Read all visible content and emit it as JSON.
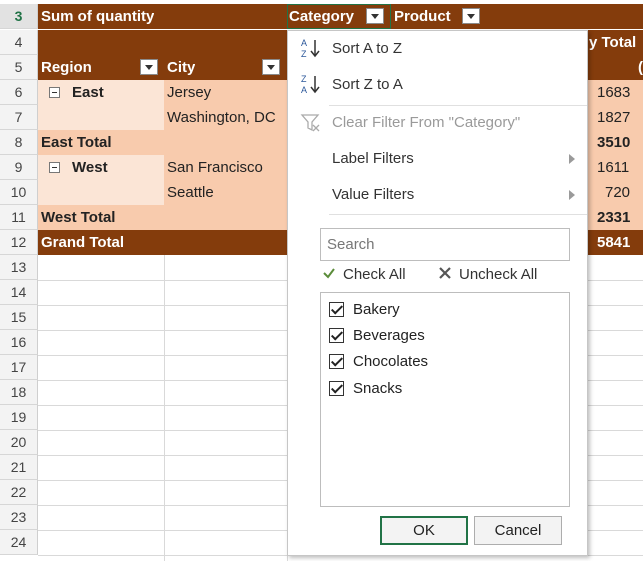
{
  "rows": [
    "3",
    "4",
    "5",
    "6",
    "7",
    "8",
    "9",
    "10",
    "11",
    "12",
    "13",
    "14",
    "15",
    "16",
    "17",
    "18",
    "19",
    "20",
    "21",
    "22",
    "23",
    "24"
  ],
  "pivot": {
    "header": {
      "sum_label": "Sum of quantity",
      "category_label": "Category",
      "product_label": "Product"
    },
    "grand_header_partial": "y Total",
    "col_header_partial": "(",
    "region_label": "Region",
    "city_label": "City",
    "east": {
      "region": "East",
      "cities": [
        "Jersey",
        "Washington, DC"
      ],
      "values": [
        "1683",
        "1827"
      ],
      "total_label": "East Total",
      "total": "3510"
    },
    "west": {
      "region": "West",
      "cities": [
        "San Francisco",
        "Seattle"
      ],
      "values": [
        "1611",
        "720"
      ],
      "total_label": "West Total",
      "total": "2331"
    },
    "grand": {
      "label": "Grand Total",
      "total": "5841"
    }
  },
  "filter_menu": {
    "sort_az": "Sort A to Z",
    "sort_za": "Sort Z to A",
    "clear_filter": "Clear Filter From \"Category\"",
    "label_filters": "Label Filters",
    "value_filters": "Value Filters",
    "search_placeholder": "Search",
    "check_all": "Check All",
    "uncheck_all": "Uncheck All",
    "items": [
      "Bakery",
      "Beverages",
      "Chocolates",
      "Snacks"
    ],
    "ok": "OK",
    "cancel": "Cancel"
  },
  "colors": {
    "header_brown": "#843c0c",
    "light_peach": "#fbe5d6",
    "peach": "#f8cbad",
    "excel_green": "#217346"
  }
}
